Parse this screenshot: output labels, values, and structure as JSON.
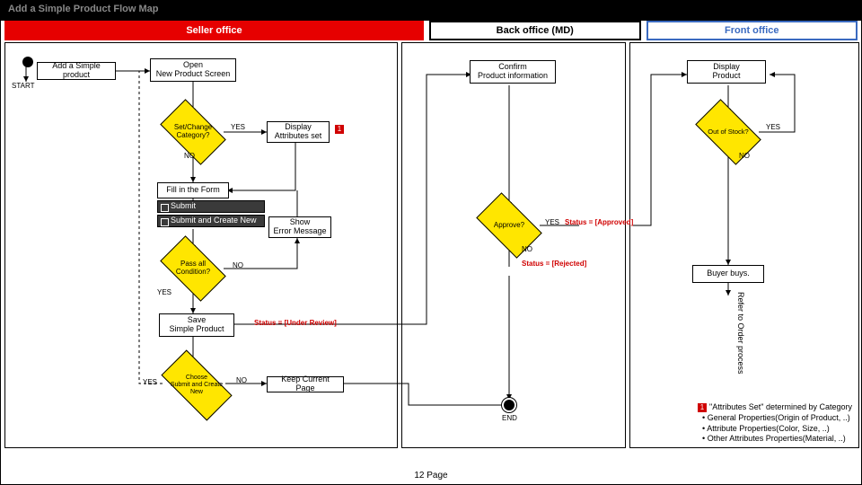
{
  "title": "Add a Simple Product Flow Map",
  "page_label": "12 Page",
  "lanes": {
    "seller": "Seller office",
    "back": "Back office (MD)",
    "front": "Front office"
  },
  "nodes": {
    "start": "START",
    "add_simple": "Add a Simple product",
    "open_screen": "Open\nNew Product Screen",
    "set_category": "Set/Change\nCategory?",
    "display_attr": "Display\nAttributes set",
    "fill_form": "Fill in the Form",
    "submit": "Submit",
    "submit_new": "Submit and Create New",
    "show_error": "Show\nError Message",
    "pass_all": "Pass all\nCondition?",
    "save_simple": "Save\nSimple Product",
    "choose_submit": "Choose\nSubmit and Create New",
    "keep_page": "Keep Current Page",
    "confirm_info": "Confirm\nProduct information",
    "approve": "Approve?",
    "status_approved": "Status = [Approved]",
    "status_rejected": "Status = [Rejected]",
    "status_review": "Status = [Under Review]",
    "end": "END",
    "display_product": "Display\nProduct",
    "out_stock": "Out of Stock?",
    "buyer_buys": "Buyer buys.",
    "refer_order": "Refer to Order process"
  },
  "labels": {
    "yes": "YES",
    "no": "NO"
  },
  "footnote": {
    "num": "1",
    "title": "\"Attributes Set\" determined by Category",
    "b1": "General Properties(Origin of Product, ..)",
    "b2": "Attribute Properties(Color, Size, ..)",
    "b3": "Other Attributes Properties(Material, ..)"
  }
}
